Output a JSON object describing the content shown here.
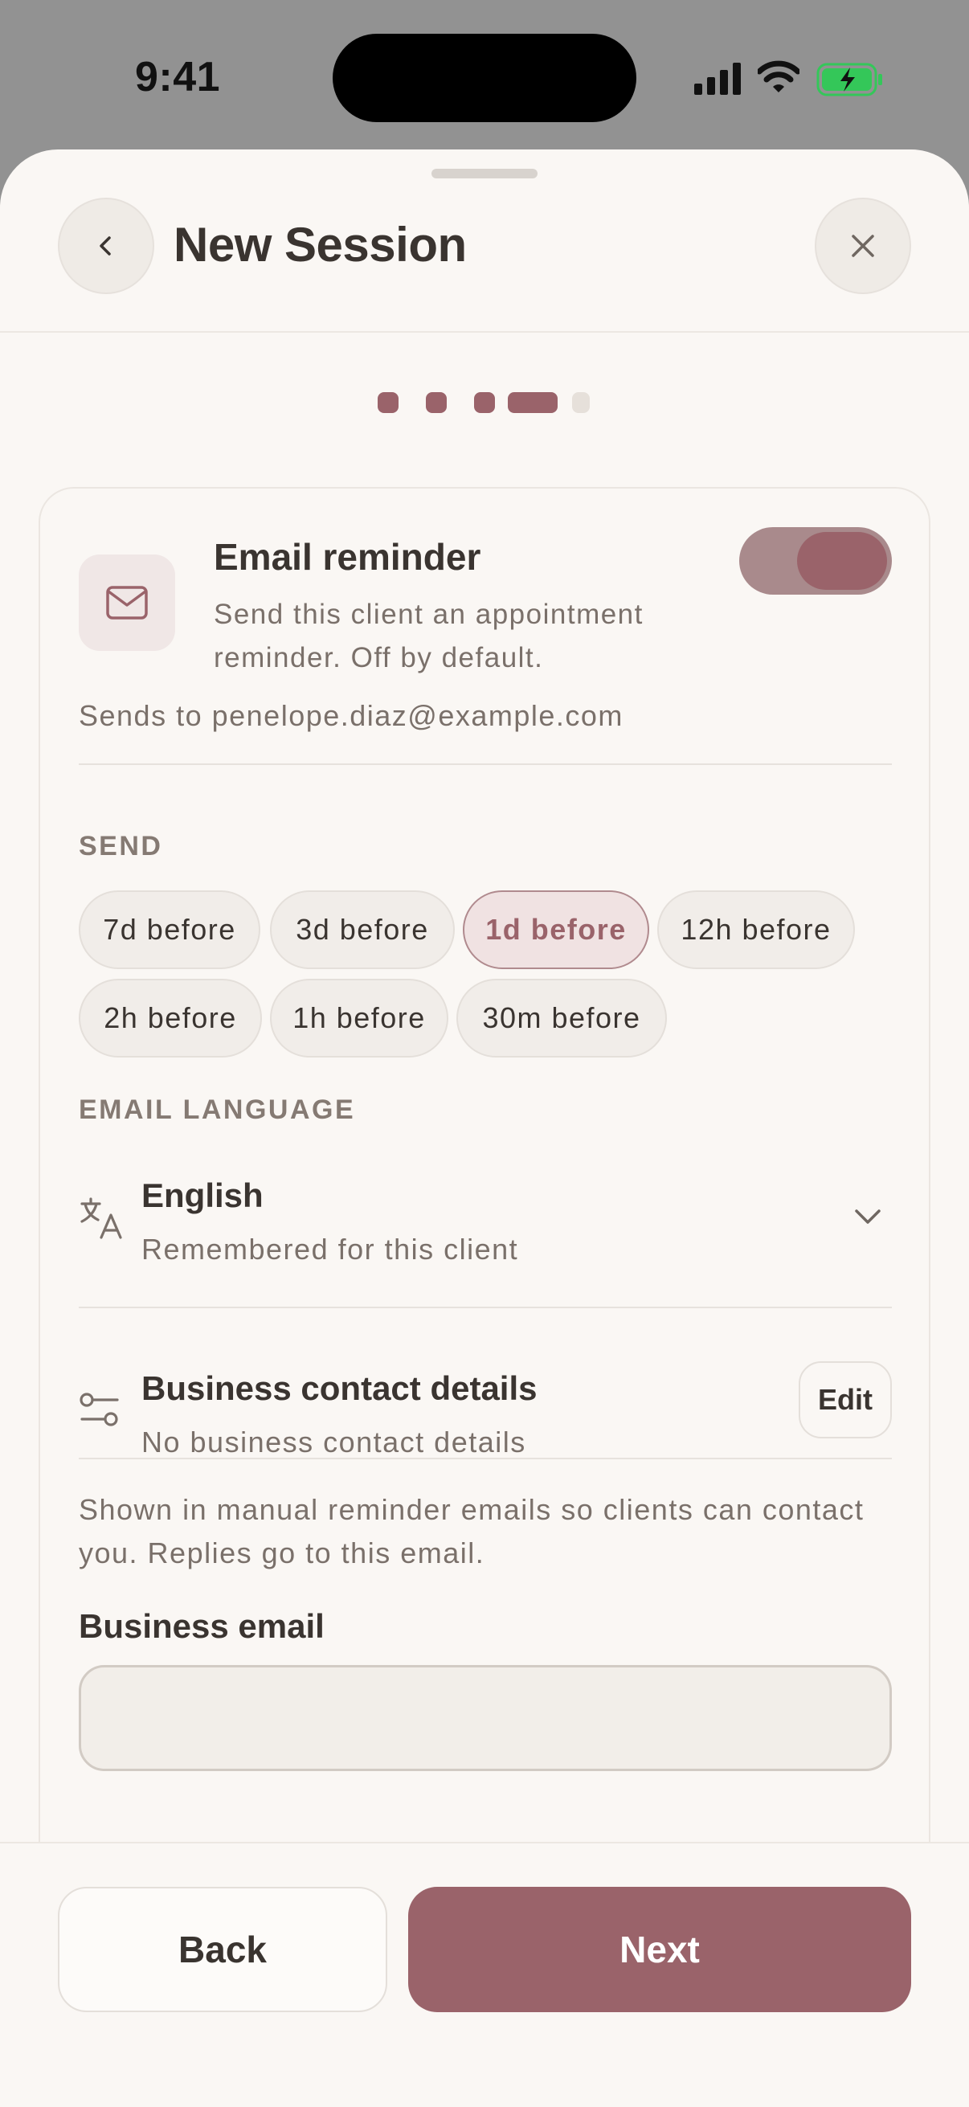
{
  "status_bar": {
    "time": "9:41",
    "signal_icon": "cellular-signal-icon",
    "wifi_icon": "wifi-icon",
    "battery_icon": "battery-charging-icon",
    "battery_color": "#34c759"
  },
  "header": {
    "title": "New Session",
    "back_icon": "chevron-left-icon",
    "close_icon": "close-icon"
  },
  "stepper": {
    "total_steps": 5,
    "current_step": 4
  },
  "reminder": {
    "icon": "mail-icon",
    "title": "Email reminder",
    "description": "Send this client an appointment reminder. Off by default.",
    "toggle_on": true,
    "sends_to": "Sends to penelope.diaz@example.com"
  },
  "send": {
    "label": "SEND",
    "options": [
      {
        "label": "7d before",
        "selected": false
      },
      {
        "label": "3d before",
        "selected": false
      },
      {
        "label": "1d before",
        "selected": true
      },
      {
        "label": "12h before",
        "selected": false
      },
      {
        "label": "2h before",
        "selected": false
      },
      {
        "label": "1h before",
        "selected": false
      },
      {
        "label": "30m before",
        "selected": false
      }
    ]
  },
  "language": {
    "label": "EMAIL LANGUAGE",
    "icon": "translate-icon",
    "value": "English",
    "note": "Remembered for this client",
    "chevron_icon": "chevron-down-icon"
  },
  "business": {
    "icon": "sliders-icon",
    "title": "Business contact details",
    "note": "No business contact details",
    "edit_label": "Edit",
    "help": "Shown in manual reminder emails so clients can contact you. Replies go to this email.",
    "email_label": "Business email",
    "email_value": "",
    "email_placeholder": ""
  },
  "footer": {
    "back_label": "Back",
    "next_label": "Next"
  },
  "colors": {
    "accent": "#9a636a",
    "background": "#faf7f4",
    "text": "#3a3430",
    "muted_text": "#7a706a"
  }
}
